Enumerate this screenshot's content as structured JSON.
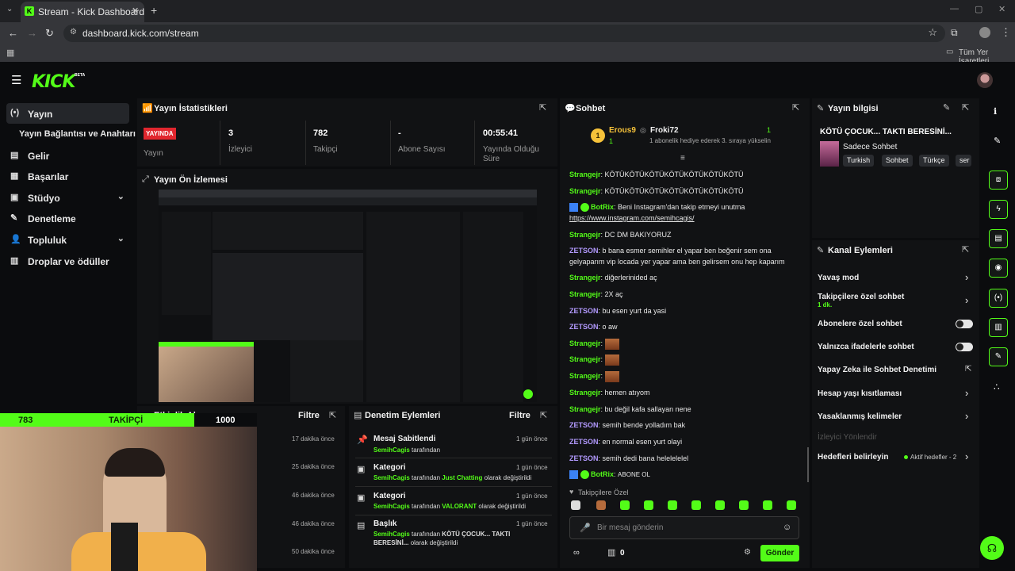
{
  "browser": {
    "tab_title": "Stream - Kick Dashboard",
    "url": "dashboard.kick.com/stream",
    "bookmarks_label": "Tüm Yer İşaretleri"
  },
  "brand": {
    "logo": "KICK",
    "beta": "BETA",
    "accent": "#53fc18"
  },
  "sidebar": {
    "items": [
      {
        "label": "Yayın",
        "icon": "broadcast-icon"
      },
      {
        "label": "Yayın Bağlantısı ve Anahtarı",
        "icon": ""
      },
      {
        "label": "Gelir",
        "icon": "revenue-icon"
      },
      {
        "label": "Başarılar",
        "icon": "achievements-icon"
      },
      {
        "label": "Stüdyo",
        "icon": "studio-icon"
      },
      {
        "label": "Denetleme",
        "icon": "moderation-icon"
      },
      {
        "label": "Topluluk",
        "icon": "community-icon"
      },
      {
        "label": "Droplar ve ödüller",
        "icon": "drops-icon"
      }
    ]
  },
  "stats": {
    "title": "Yayın İstatistikleri",
    "live_badge": "YAYINDA",
    "items": [
      {
        "value": "",
        "label": "Yayın"
      },
      {
        "value": "3",
        "label": "İzleyici"
      },
      {
        "value": "782",
        "label": "Takipçi"
      },
      {
        "value": "-",
        "label": "Abone Sayısı"
      },
      {
        "value": "00:55:41",
        "label": "Yayında Olduğu Süre"
      }
    ]
  },
  "preview": {
    "title": "Yayın Ön İzlemesi"
  },
  "activity": {
    "title": "Etkinlik Akışı",
    "filter": "Filtre",
    "times": [
      "17 dakika önce",
      "25 dakika önce",
      "46 dakika önce",
      "46 dakika önce",
      "50 dakika önce"
    ]
  },
  "overlay": {
    "followers": "783",
    "label": "TAKİPÇİ",
    "goal": "1000"
  },
  "modlog": {
    "title": "Denetim Eylemleri",
    "filter": "Filtre",
    "entries": [
      {
        "title": "Mesaj Sabitlendi",
        "time": "1 gün önce",
        "user": "SemihCagis",
        "text": "tarafından"
      },
      {
        "title": "Kategori",
        "time": "1 gün önce",
        "user": "SemihCagis",
        "text": "tarafından",
        "value": "Just Chatting",
        "suffix": "olarak değiştirildi"
      },
      {
        "title": "Kategori",
        "time": "1 gün önce",
        "user": "SemihCagis",
        "text": "tarafından",
        "value": "VALORANT",
        "suffix": "olarak değiştirildi"
      },
      {
        "title": "Başlık",
        "time": "1 gün önce",
        "user": "SemihCagis",
        "text": "tarafından",
        "value": "KÖTÜ ÇOCUK... TAKTI",
        "value2": "BERESİNİ...",
        "suffix": "olarak değiştirildi"
      }
    ]
  },
  "chat": {
    "title": "Sohbet",
    "pinned": {
      "rank": "1",
      "user1": "Erous9",
      "count1": "1",
      "user2": "Froki72",
      "count2": "1",
      "message": "1 abonelik hediye ederek 3. sıraya yükselin"
    },
    "messages": [
      {
        "user": "Strangejr",
        "text": "KÖTÜKÖTÜKÖTÜKÖTÜKÖTÜKÖTÜKÖTÜ"
      },
      {
        "user": "Strangejr",
        "text": "KÖTÜKÖTÜKÖTÜKÖTÜKÖTÜKÖTÜKÖTÜ"
      },
      {
        "user": "BotRix",
        "text": "Beni Instagram'dan takip etmeyi unutma",
        "link": "https://www.instagram.com/semihcagis/"
      },
      {
        "user": "Strangejr",
        "text": "DC DM BAKIYORUZ"
      },
      {
        "user": "ZETSON",
        "text": "b bana esmer semihler el yapar ben beğenir sem ona gelyaparım vip locada yer yapar ama ben gelirsem onu hep kaparım"
      },
      {
        "user": "Strangejr",
        "text": "diğerlerinided aç"
      },
      {
        "user": "Strangejr",
        "text": "2X aç"
      },
      {
        "user": "ZETSON",
        "text": "bu esen yurt da yasi"
      },
      {
        "user": "ZETSON",
        "text": "o aw"
      },
      {
        "user": "Strangejr",
        "text": ""
      },
      {
        "user": "Strangejr",
        "text": ""
      },
      {
        "user": "Strangejr",
        "text": ""
      },
      {
        "user": "Strangejr",
        "text": "hemen atıyom"
      },
      {
        "user": "Strangejr",
        "text": "bu değil kafa sallayan nene"
      },
      {
        "user": "ZETSON",
        "text": "semih bende yolladım bak"
      },
      {
        "user": "ZETSON",
        "text": "en normal esen yurt olayi"
      },
      {
        "user": "ZETSON",
        "text": "semih dedi bana helelelelel"
      },
      {
        "user": "BotRix",
        "text": "ABONE OL"
      }
    ],
    "followers_only": "Takipçilere Özel",
    "input_placeholder": "Bir mesaj gönderin",
    "send": "Gönder",
    "points": "0"
  },
  "info": {
    "title": "Yayın bilgisi",
    "stream_title": "KÖTÜ ÇOCUK... TAKTI BERESİNİ...",
    "category": "Sadece Sohbet",
    "tags": [
      "Turkish",
      "Sohbet",
      "Türkçe",
      "ser"
    ]
  },
  "actions": {
    "title": "Kanal Eylemleri",
    "items": [
      {
        "label": "Yavaş mod",
        "control": "chevron"
      },
      {
        "label": "Takipçilere özel sohbet",
        "sub": "1 dk.",
        "control": "chevron"
      },
      {
        "label": "Abonelere özel sohbet",
        "control": "toggle"
      },
      {
        "label": "Yalnızca ifadelerle sohbet",
        "control": "toggle"
      },
      {
        "label": "Yapay Zeka ile Sohbet Denetimi",
        "control": "external"
      },
      {
        "label": "Hesap yaşı kısıtlaması",
        "control": "chevron"
      },
      {
        "label": "Yasaklanmış kelimeler",
        "control": "chevron"
      },
      {
        "label": "İzleyici Yönlendir",
        "control": "none"
      },
      {
        "label": "Hedefleri belirleyin",
        "status": "Aktif hedefler - 2",
        "control": "chevron"
      }
    ]
  }
}
